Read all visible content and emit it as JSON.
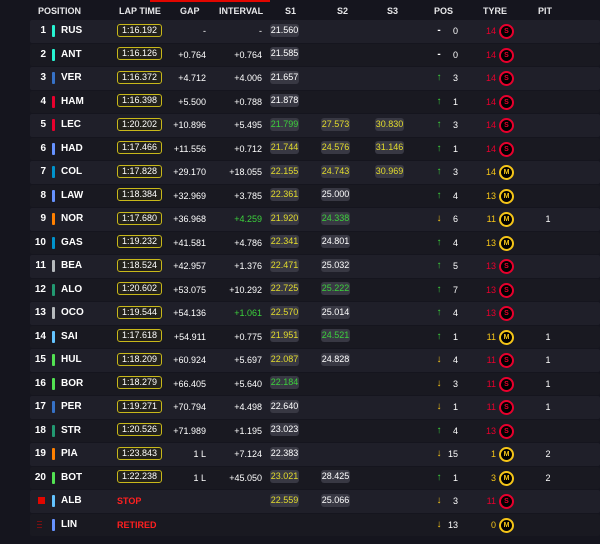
{
  "header": {
    "position": "POSITION",
    "lap_time": "LAP TIME",
    "gap": "GAP",
    "interval": "INTERVAL",
    "s1": "S1",
    "s2": "S2",
    "s3": "S3",
    "pos": "POS",
    "tyre": "TYRE",
    "pit": "PIT"
  },
  "colors": {
    "accent_red": "#e10600",
    "sector_green": "#3cd13c",
    "sector_yellow": "#e4dd2c",
    "soft_tyre": "#e8002d",
    "medium_tyre": "#f5c518"
  },
  "rows": [
    {
      "pos": "1",
      "code": "RUS",
      "team_color": "#27f4d2",
      "lap": "1:16.192",
      "gap": "-",
      "int": "-",
      "s1": "21.560",
      "s1c": "white",
      "s2": "",
      "s2c": "",
      "s3": "",
      "s3c": "",
      "arrow": "-",
      "posnum": "0",
      "tyrenum": "14",
      "tyre": "S",
      "tyreclass": "soft",
      "pit": ""
    },
    {
      "pos": "2",
      "code": "ANT",
      "team_color": "#27f4d2",
      "lap": "1:16.126",
      "gap": "+0.764",
      "int": "+0.764",
      "s1": "21.585",
      "s1c": "white",
      "s2": "",
      "s2c": "",
      "s3": "",
      "s3c": "",
      "arrow": "-",
      "posnum": "0",
      "tyrenum": "14",
      "tyre": "S",
      "tyreclass": "soft",
      "pit": ""
    },
    {
      "pos": "3",
      "code": "VER",
      "team_color": "#3671c6",
      "lap": "1:16.372",
      "gap": "+4.712",
      "int": "+4.006",
      "s1": "21.657",
      "s1c": "white",
      "s2": "",
      "s2c": "",
      "s3": "",
      "s3c": "",
      "arrow": "up",
      "posnum": "3",
      "tyrenum": "14",
      "tyre": "S",
      "tyreclass": "soft",
      "pit": ""
    },
    {
      "pos": "4",
      "code": "HAM",
      "team_color": "#e8002d",
      "lap": "1:16.398",
      "gap": "+5.500",
      "int": "+0.788",
      "s1": "21.878",
      "s1c": "white",
      "s2": "",
      "s2c": "",
      "s3": "",
      "s3c": "",
      "arrow": "up",
      "posnum": "1",
      "tyrenum": "14",
      "tyre": "S",
      "tyreclass": "soft",
      "pit": ""
    },
    {
      "pos": "5",
      "code": "LEC",
      "team_color": "#e8002d",
      "lap": "1:20.202",
      "gap": "+10.896",
      "int": "+5.495",
      "s1": "21.799",
      "s1c": "green",
      "s2": "27.573",
      "s2c": "yellow",
      "s3": "30.830",
      "s3c": "yellow",
      "arrow": "up",
      "posnum": "3",
      "tyrenum": "14",
      "tyre": "S",
      "tyreclass": "soft",
      "pit": ""
    },
    {
      "pos": "6",
      "code": "HAD",
      "team_color": "#6692ff",
      "lap": "1:17.466",
      "gap": "+11.556",
      "int": "+0.712",
      "s1": "21.744",
      "s1c": "yellow",
      "s2": "24.576",
      "s2c": "yellow",
      "s3": "31.146",
      "s3c": "yellow",
      "arrow": "up",
      "posnum": "1",
      "tyrenum": "14",
      "tyre": "S",
      "tyreclass": "soft",
      "pit": ""
    },
    {
      "pos": "7",
      "code": "COL",
      "team_color": "#0093cc",
      "lap": "1:17.828",
      "gap": "+29.170",
      "int": "+18.055",
      "s1": "22.155",
      "s1c": "yellow",
      "s2": "24.743",
      "s2c": "yellow",
      "s3": "30.969",
      "s3c": "yellow",
      "arrow": "up",
      "posnum": "3",
      "tyrenum": "14",
      "tyre": "M",
      "tyreclass": "med",
      "pit": ""
    },
    {
      "pos": "8",
      "code": "LAW",
      "team_color": "#6692ff",
      "lap": "1:18.384",
      "gap": "+32.969",
      "int": "+3.785",
      "s1": "22.361",
      "s1c": "yellow",
      "s2": "25.000",
      "s2c": "white",
      "s3": "",
      "s3c": "",
      "arrow": "up",
      "posnum": "4",
      "tyrenum": "13",
      "tyre": "M",
      "tyreclass": "med",
      "pit": ""
    },
    {
      "pos": "9",
      "code": "NOR",
      "team_color": "#ff8000",
      "lap": "1:17.680",
      "gap": "+36.968",
      "int": "+4.259",
      "s1": "21.920",
      "s1c": "yellow",
      "s2": "24.338",
      "s2c": "green",
      "s3": "",
      "s3c": "",
      "arrow": "down",
      "posnum": "6",
      "tyrenum": "11",
      "tyre": "M",
      "tyreclass": "med",
      "pit": "1"
    },
    {
      "pos": "10",
      "code": "GAS",
      "team_color": "#0093cc",
      "lap": "1:19.232",
      "gap": "+41.581",
      "int": "+4.786",
      "s1": "22.341",
      "s1c": "yellow",
      "s2": "24.801",
      "s2c": "white",
      "s3": "",
      "s3c": "",
      "arrow": "up",
      "posnum": "4",
      "tyrenum": "13",
      "tyre": "M",
      "tyreclass": "med",
      "pit": ""
    },
    {
      "pos": "11",
      "code": "BEA",
      "team_color": "#b6babd",
      "lap": "1:18.524",
      "gap": "+42.957",
      "int": "+1.376",
      "s1": "22.471",
      "s1c": "yellow",
      "s2": "25.032",
      "s2c": "white",
      "s3": "",
      "s3c": "",
      "arrow": "up",
      "posnum": "5",
      "tyrenum": "13",
      "tyre": "S",
      "tyreclass": "soft",
      "pit": ""
    },
    {
      "pos": "12",
      "code": "ALO",
      "team_color": "#229971",
      "lap": "1:20.602",
      "gap": "+53.075",
      "int": "+10.292",
      "s1": "22.725",
      "s1c": "yellow",
      "s2": "25.222",
      "s2c": "green",
      "s3": "",
      "s3c": "",
      "arrow": "up",
      "posnum": "7",
      "tyrenum": "13",
      "tyre": "S",
      "tyreclass": "soft",
      "pit": ""
    },
    {
      "pos": "13",
      "code": "OCO",
      "team_color": "#b6babd",
      "lap": "1:19.544",
      "gap": "+54.136",
      "int": "+1.061",
      "s1": "22.570",
      "s1c": "yellow",
      "s2": "25.014",
      "s2c": "white",
      "s3": "",
      "s3c": "",
      "arrow": "up",
      "posnum": "4",
      "tyrenum": "13",
      "tyre": "S",
      "tyreclass": "soft",
      "pit": ""
    },
    {
      "pos": "14",
      "code": "SAI",
      "team_color": "#64c4ff",
      "lap": "1:17.618",
      "gap": "+54.911",
      "int": "+0.775",
      "s1": "21.951",
      "s1c": "yellow",
      "s2": "24.521",
      "s2c": "green",
      "s3": "",
      "s3c": "",
      "arrow": "up",
      "posnum": "1",
      "tyrenum": "11",
      "tyre": "M",
      "tyreclass": "med",
      "pit": "1"
    },
    {
      "pos": "15",
      "code": "HUL",
      "team_color": "#52e252",
      "lap": "1:18.209",
      "gap": "+60.924",
      "int": "+5.697",
      "s1": "22.087",
      "s1c": "yellow",
      "s2": "24.828",
      "s2c": "white",
      "s3": "",
      "s3c": "",
      "arrow": "down",
      "posnum": "4",
      "tyrenum": "11",
      "tyre": "S",
      "tyreclass": "soft",
      "pit": "1"
    },
    {
      "pos": "16",
      "code": "BOR",
      "team_color": "#52e252",
      "lap": "1:18.279",
      "gap": "+66.405",
      "int": "+5.640",
      "s1": "22.184",
      "s1c": "green",
      "s2": "",
      "s2c": "",
      "s3": "",
      "s3c": "",
      "arrow": "down",
      "posnum": "3",
      "tyrenum": "11",
      "tyre": "S",
      "tyreclass": "soft",
      "pit": "1"
    },
    {
      "pos": "17",
      "code": "PER",
      "team_color": "#3671c6",
      "lap": "1:19.271",
      "gap": "+70.794",
      "int": "+4.498",
      "s1": "22.640",
      "s1c": "white",
      "s2": "",
      "s2c": "",
      "s3": "",
      "s3c": "",
      "arrow": "down",
      "posnum": "1",
      "tyrenum": "11",
      "tyre": "S",
      "tyreclass": "soft",
      "pit": "1"
    },
    {
      "pos": "18",
      "code": "STR",
      "team_color": "#229971",
      "lap": "1:20.526",
      "gap": "+71.989",
      "int": "+1.195",
      "s1": "23.023",
      "s1c": "white",
      "s2": "",
      "s2c": "",
      "s3": "",
      "s3c": "",
      "arrow": "up",
      "posnum": "4",
      "tyrenum": "13",
      "tyre": "S",
      "tyreclass": "soft",
      "pit": ""
    },
    {
      "pos": "19",
      "code": "PIA",
      "team_color": "#ff8000",
      "lap": "1:23.843",
      "gap": "1 L",
      "int": "+7.124",
      "s1": "22.383",
      "s1c": "white",
      "s2": "",
      "s2c": "",
      "s3": "",
      "s3c": "",
      "arrow": "down",
      "posnum": "15",
      "tyrenum": "1",
      "tyre": "M",
      "tyreclass": "med",
      "pit": "2"
    },
    {
      "pos": "20",
      "code": "BOT",
      "team_color": "#52e252",
      "lap": "1:22.238",
      "gap": "1 L",
      "int": "+45.050",
      "s1": "23.021",
      "s1c": "yellow",
      "s2": "28.425",
      "s2c": "white",
      "s3": "",
      "s3c": "",
      "arrow": "up",
      "posnum": "1",
      "tyrenum": "3",
      "tyre": "M",
      "tyreclass": "med",
      "pit": "2"
    },
    {
      "pos": "",
      "flag": "square",
      "code": "ALB",
      "team_color": "#64c4ff",
      "lap": "",
      "status": "STOP",
      "gap": "",
      "int": "",
      "s1": "22.559",
      "s1c": "yellow",
      "s2": "25.066",
      "s2c": "white",
      "s3": "",
      "s3c": "",
      "arrow": "down",
      "posnum": "3",
      "tyrenum": "11",
      "tyre": "S",
      "tyreclass": "soft",
      "pit": ""
    },
    {
      "pos": "",
      "flag": "lines",
      "code": "LIN",
      "team_color": "#6692ff",
      "lap": "",
      "status": "RETIRED",
      "gap": "",
      "int": "",
      "s1": "",
      "s1c": "",
      "s2": "",
      "s2c": "",
      "s3": "",
      "s3c": "",
      "arrow": "down",
      "posnum": "13",
      "tyrenum": "0",
      "tyre": "M",
      "tyreclass": "med",
      "pit": ""
    }
  ]
}
